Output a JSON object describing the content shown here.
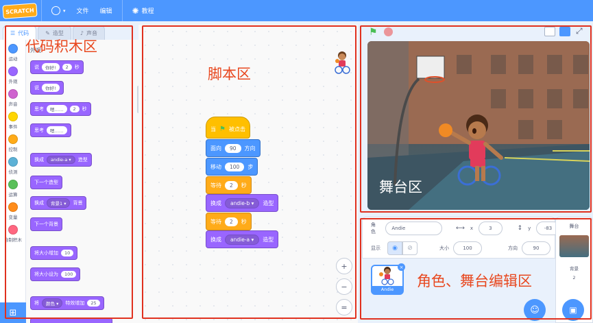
{
  "menubar": {
    "logo": "SCRATCH",
    "file": "文件",
    "edit": "编辑",
    "tutorials": "教程",
    "globe_icon": "globe-icon",
    "bulb_icon": "lightbulb-icon"
  },
  "tabs": [
    {
      "label": "代码",
      "active": true
    },
    {
      "label": "造型",
      "active": false
    },
    {
      "label": "声音",
      "active": false
    }
  ],
  "categories": [
    {
      "label": "运动",
      "color": "#4c97ff"
    },
    {
      "label": "外观",
      "color": "#9966ff"
    },
    {
      "label": "声音",
      "color": "#cf63cf"
    },
    {
      "label": "事件",
      "color": "#ffd500"
    },
    {
      "label": "控制",
      "color": "#ffab19"
    },
    {
      "label": "侦测",
      "color": "#5cb1d6"
    },
    {
      "label": "运算",
      "color": "#59c059"
    },
    {
      "label": "变量",
      "color": "#ff8c1a"
    },
    {
      "label": "自制积木",
      "color": "#ff6680"
    }
  ],
  "palette": {
    "heading": "外观",
    "blocks": [
      {
        "pre": "说",
        "arg1": "你好!",
        "arg2": "2",
        "post": "秒"
      },
      {
        "pre": "说",
        "arg1": "你好!"
      },
      {
        "pre": "思考",
        "arg1": "嗯……",
        "arg2": "2",
        "post": "秒"
      },
      {
        "pre": "思考",
        "arg1": "嗯……"
      },
      {
        "pre": "换成",
        "drop": "andie-a ▾",
        "post": "造型"
      },
      {
        "pre": "下一个造型"
      },
      {
        "pre": "换成",
        "drop": "背景1 ▾",
        "post": "背景"
      },
      {
        "pre": "下一个背景"
      },
      {
        "pre": "将大小增加",
        "arg1": "10"
      },
      {
        "pre": "将大小设为",
        "arg1": "100"
      },
      {
        "pre": "将",
        "drop": "颜色 ▾",
        "mid": "特效增加",
        "arg1": "25"
      }
    ]
  },
  "script": {
    "hat": {
      "pre": "当",
      "post": "被点击"
    },
    "point": {
      "pre": "面向",
      "arg": "90",
      "post": "方向"
    },
    "move": {
      "pre": "移动",
      "arg": "100",
      "post": "步"
    },
    "wait1": {
      "pre": "等待",
      "arg": "2",
      "post": "秒"
    },
    "switch1": {
      "pre": "换成",
      "drop": "andie-b ▾",
      "post": "造型"
    },
    "wait2": {
      "pre": "等待",
      "arg": "2",
      "post": "秒"
    },
    "switch2": {
      "pre": "换成",
      "drop": "andie-a ▾",
      "post": "造型"
    },
    "zoom_in": "+",
    "zoom_out": "−",
    "zoom_reset": "="
  },
  "sprite_info": {
    "sprite_label": "角色",
    "sprite_name": "Andie",
    "x_label": "x",
    "x_value": "3",
    "y_label": "y",
    "y_value": "-83",
    "show_label": "显示",
    "size_label": "大小",
    "size_value": "100",
    "direction_label": "方向",
    "direction_value": "90",
    "thumb_name": "Andie"
  },
  "stage_pane": {
    "title": "舞台",
    "backdrops_label": "背景",
    "backdrops_count": "2"
  },
  "annotations": {
    "palette": "代码积木区",
    "script": "脚本区",
    "stage": "舞台区",
    "editor": "角色、舞台编辑区"
  }
}
